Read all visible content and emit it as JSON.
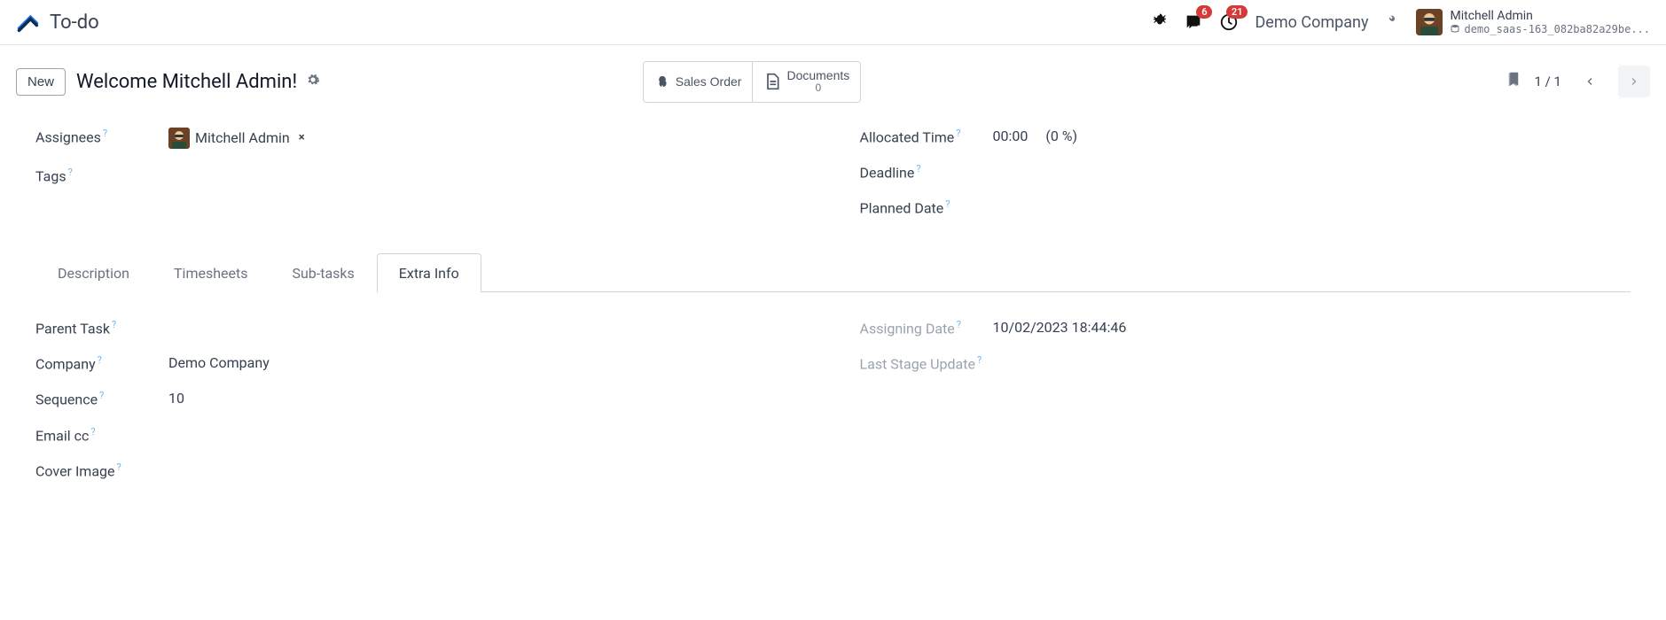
{
  "header": {
    "app_title": "To-do",
    "messages_badge": "6",
    "activities_badge": "21",
    "company": "Demo Company",
    "user_name": "Mitchell Admin",
    "db_name": "demo_saas-163_082ba82a29be..."
  },
  "toolbar": {
    "new_label": "New",
    "record_title": "Welcome Mitchell Admin!",
    "sales_order_label": "Sales Order",
    "documents_label": "Documents",
    "documents_count": "0",
    "pager": "1 / 1"
  },
  "fields": {
    "assignees_label": "Assignees",
    "assignee_value": "Mitchell Admin",
    "tags_label": "Tags",
    "allocated_time_label": "Allocated Time",
    "allocated_time_value": "00:00",
    "allocated_pct": "(0 %)",
    "deadline_label": "Deadline",
    "planned_date_label": "Planned Date"
  },
  "tabs": {
    "description": "Description",
    "timesheets": "Timesheets",
    "subtasks": "Sub-tasks",
    "extra_info": "Extra Info"
  },
  "extra": {
    "parent_task_label": "Parent Task",
    "company_label": "Company",
    "company_value": "Demo Company",
    "sequence_label": "Sequence",
    "sequence_value": "10",
    "email_cc_label": "Email cc",
    "cover_image_label": "Cover Image",
    "assigning_date_label": "Assigning Date",
    "assigning_date_value": "10/02/2023 18:44:46",
    "last_stage_label": "Last Stage Update"
  }
}
